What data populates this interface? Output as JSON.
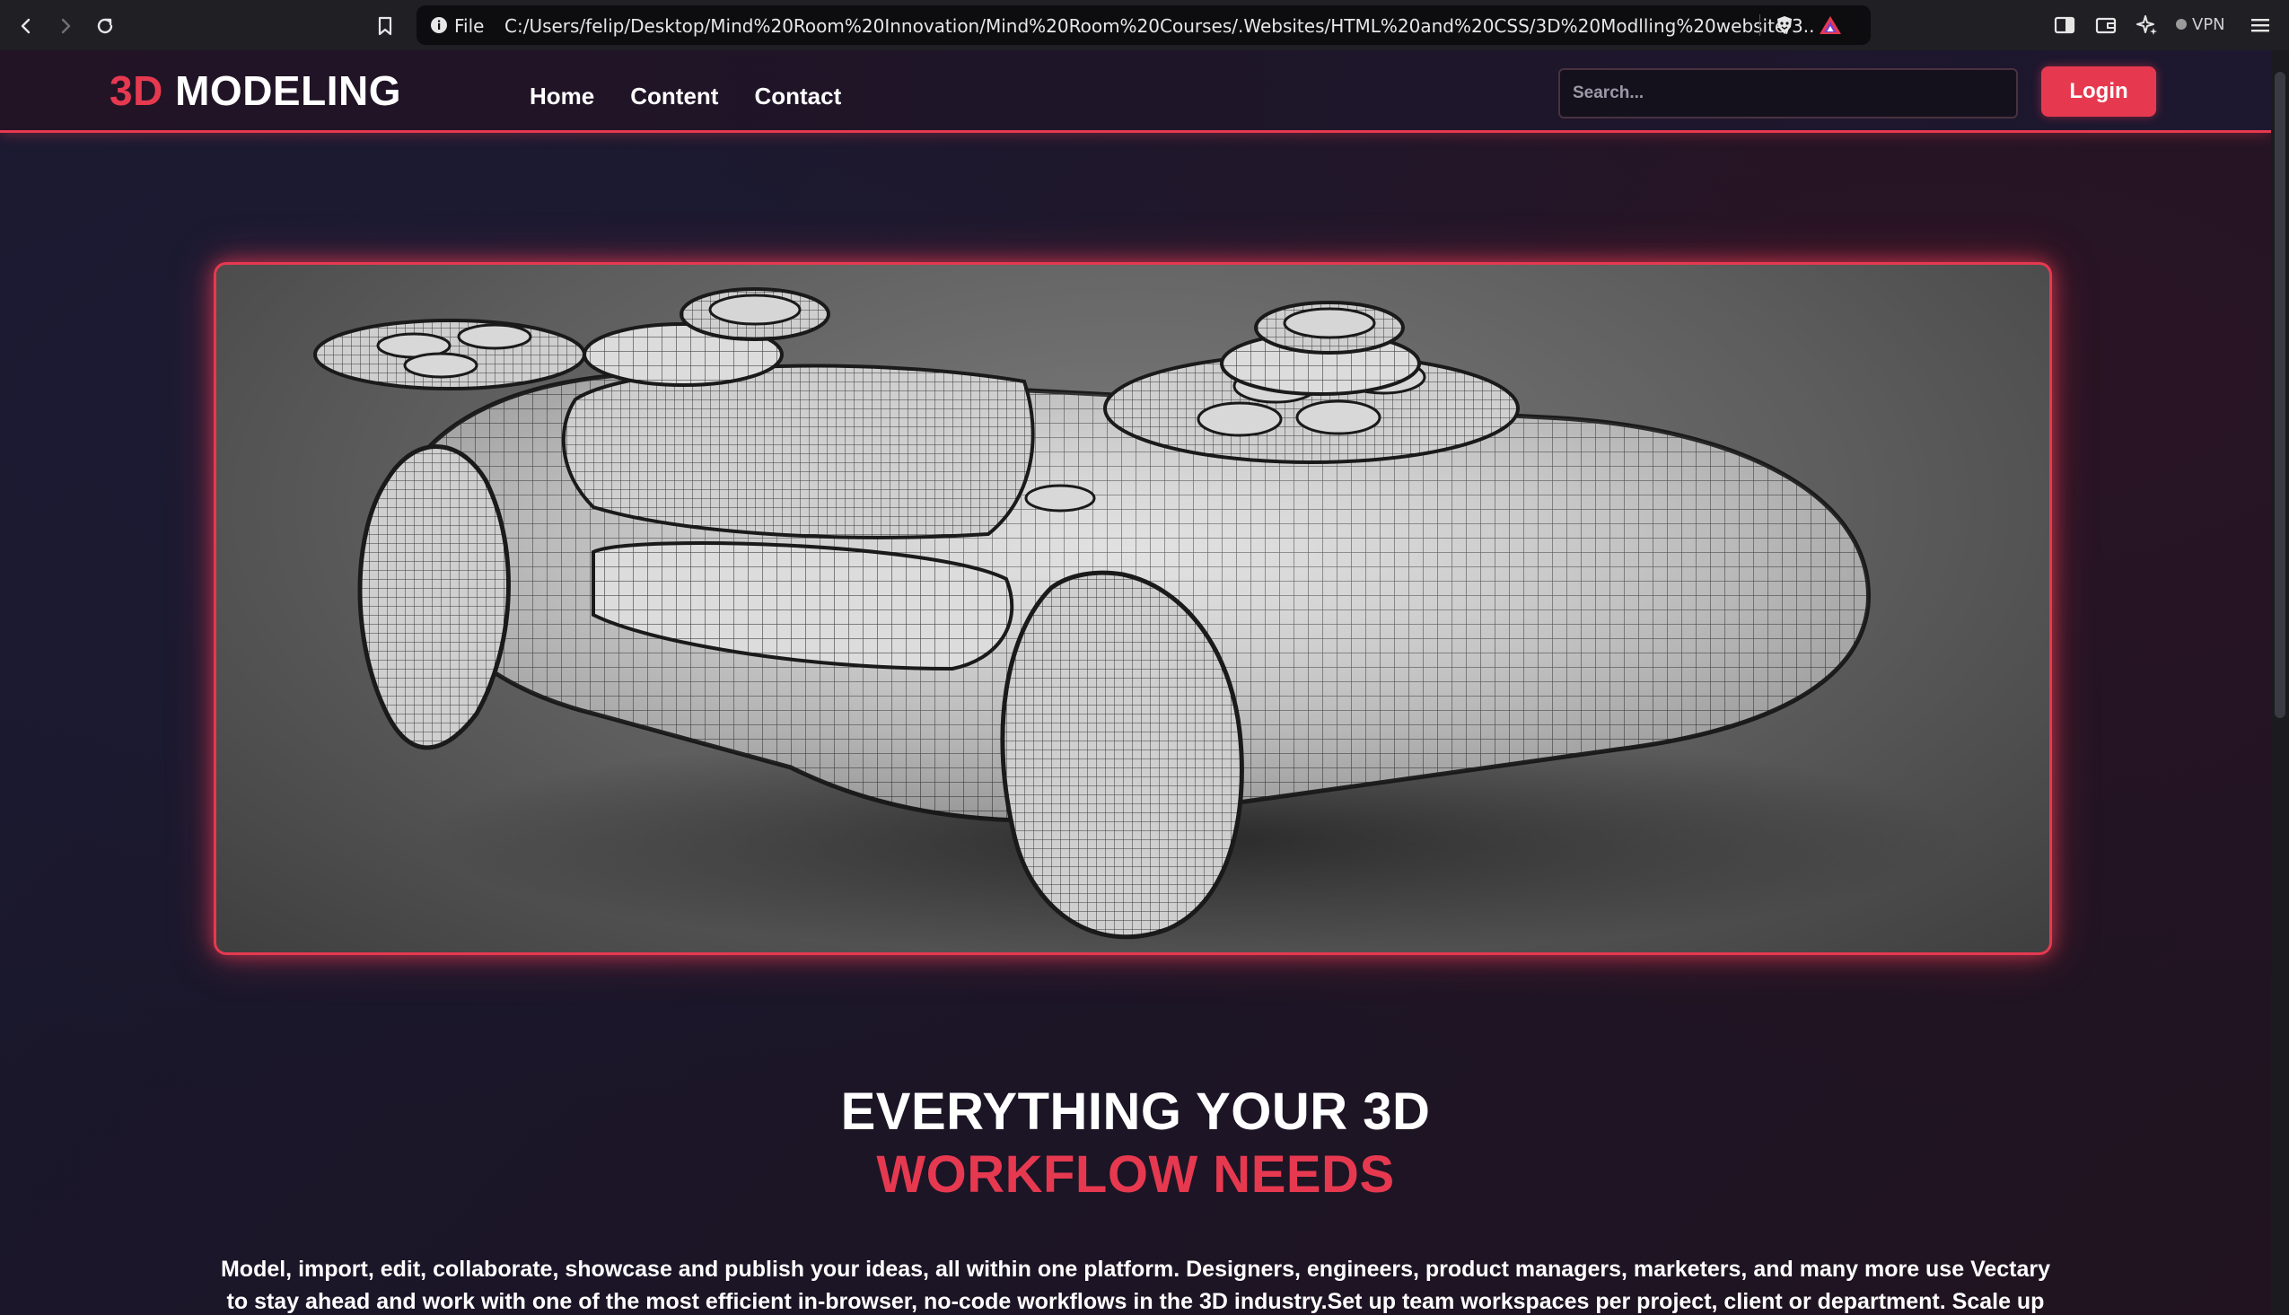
{
  "browser": {
    "address_prefix": "File",
    "url": "C:/Users/felip/Desktop/Mind%20Room%20Innovation/Mind%20Room%20Courses/.Websites/HTML%20and%20CSS/3D%20Modlling%20website/3...",
    "vpn_label": "VPN",
    "icons": [
      "back-icon",
      "forward-icon",
      "reload-icon",
      "bookmark-icon",
      "info-icon",
      "brave-shield-icon",
      "brave-rewards-icon",
      "sidebar-icon",
      "wallet-icon",
      "leo-ai-icon",
      "menu-icon"
    ]
  },
  "site": {
    "logo_accent": "3D",
    "logo_text": "MODELING",
    "nav": [
      {
        "label": "Home"
      },
      {
        "label": "Content"
      },
      {
        "label": "Contact"
      }
    ],
    "search_placeholder": "Search...",
    "login_label": "Login"
  },
  "hero": {
    "image_subject": "3D wireframe game controller model"
  },
  "headline": {
    "line1": "EVERYTHING YOUR 3D",
    "line2": "WORKFLOW NEEDS"
  },
  "description": "Model, import, edit, collaborate, showcase and publish your ideas, all within one platform. Designers, engineers, product managers, marketers, and many more use Vectary to stay ahead and work with one of the most efficient in-browser, no-code workflows in the 3D industry.Set up team workspaces per project, client or department. Scale up as you go. Store",
  "colors": {
    "accent": "#e63950",
    "background": "#1b1527",
    "text": "#ffffff"
  }
}
